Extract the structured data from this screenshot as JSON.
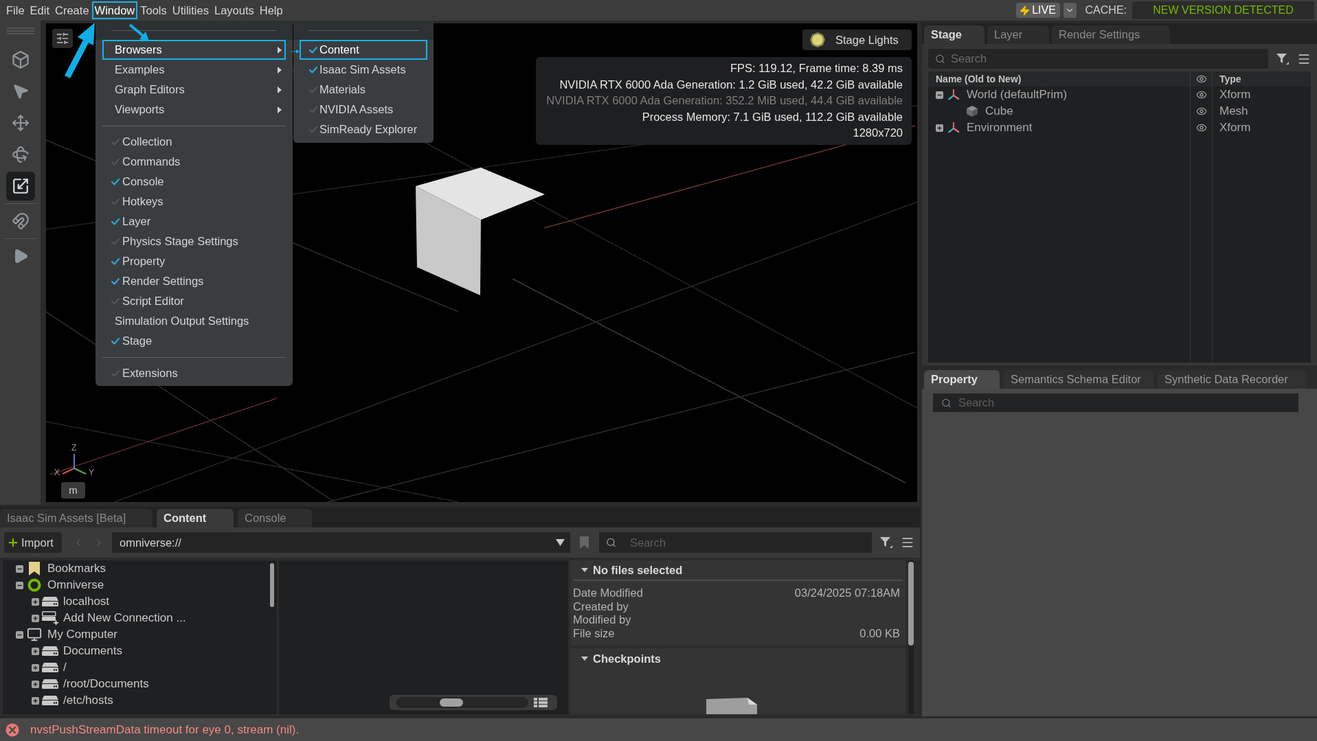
{
  "menubar": {
    "items": [
      {
        "label": "File",
        "selected": false
      },
      {
        "label": "Edit",
        "selected": false
      },
      {
        "label": "Create",
        "selected": false
      },
      {
        "label": "Window",
        "selected": true
      },
      {
        "label": "Tools",
        "selected": false
      },
      {
        "label": "Utilities",
        "selected": false
      },
      {
        "label": "Layouts",
        "selected": false
      },
      {
        "label": "Help",
        "selected": false
      }
    ],
    "live_button": "LIVE",
    "cache_label": "CACHE:",
    "cache_status": "NEW VERSION DETECTED"
  },
  "left_toolbar": {
    "groups": [
      {
        "tools": [
          {
            "kind": "select-mode",
            "selected": false
          },
          {
            "kind": "select",
            "selected": false
          },
          {
            "kind": "move",
            "selected": false
          },
          {
            "kind": "rotate",
            "selected": false
          },
          {
            "kind": "scale",
            "selected": true
          }
        ]
      },
      {
        "tools": [
          {
            "kind": "snap",
            "selected": false
          }
        ]
      },
      {
        "tools": [
          {
            "kind": "play",
            "selected": false
          }
        ]
      }
    ]
  },
  "window_menu": {
    "items": [
      {
        "kind": "submenu",
        "label": "Browsers",
        "selected": true
      },
      {
        "kind": "submenu",
        "label": "Examples",
        "selected": false
      },
      {
        "kind": "submenu",
        "label": "Graph Editors",
        "selected": false
      },
      {
        "kind": "submenu",
        "label": "Viewports",
        "selected": false
      },
      {
        "kind": "separator"
      },
      {
        "kind": "toggle",
        "label": "Collection",
        "checked": false
      },
      {
        "kind": "toggle",
        "label": "Commands",
        "checked": false
      },
      {
        "kind": "toggle",
        "label": "Console",
        "checked": true
      },
      {
        "kind": "toggle",
        "label": "Hotkeys",
        "checked": false
      },
      {
        "kind": "toggle",
        "label": "Layer",
        "checked": true
      },
      {
        "kind": "toggle",
        "label": "Physics Stage Settings",
        "checked": false
      },
      {
        "kind": "toggle",
        "label": "Property",
        "checked": true
      },
      {
        "kind": "toggle",
        "label": "Render Settings",
        "checked": true
      },
      {
        "kind": "toggle",
        "label": "Script Editor",
        "checked": false
      },
      {
        "kind": "plain",
        "label": "Simulation Output Settings"
      },
      {
        "kind": "toggle",
        "label": "Stage",
        "checked": true
      },
      {
        "kind": "separator"
      },
      {
        "kind": "toggle",
        "label": "Extensions",
        "checked": false
      }
    ]
  },
  "browsers_submenu": {
    "items": [
      {
        "label": "Content",
        "checked": true,
        "selected": true
      },
      {
        "label": "Isaac Sim Assets",
        "checked": true,
        "selected": false
      },
      {
        "label": "Materials",
        "checked": false,
        "selected": false
      },
      {
        "label": "NVIDIA Assets",
        "checked": false,
        "selected": false
      },
      {
        "label": "SimReady Explorer",
        "checked": false,
        "selected": false
      }
    ]
  },
  "viewport": {
    "stage_lights": "Stage Lights",
    "stats": [
      {
        "text": "FPS: 119.12, Frame time: 8.39 ms",
        "dimmed": false
      },
      {
        "text": "NVIDIA RTX 6000 Ada Generation: 1.2 GiB used, 42.2 GiB available",
        "dimmed": false
      },
      {
        "text": "NVIDIA RTX 6000 Ada Generation: 352.2 MiB used, 44.4 GiB available",
        "dimmed": true
      },
      {
        "text": "Process Memory: 7.1 GiB used, 112.2 GiB available",
        "dimmed": false
      },
      {
        "text": "1280x720",
        "dimmed": false
      }
    ],
    "axes": [
      "Z",
      "X",
      "Y"
    ],
    "unit_button": "m"
  },
  "stage_panel": {
    "tabs": [
      {
        "label": "Stage",
        "selected": true
      },
      {
        "label": "Layer",
        "selected": false
      },
      {
        "label": "Render Settings",
        "selected": false
      }
    ],
    "search": {
      "placeholder": "Search"
    },
    "columns": [
      "Name (Old to New)",
      "Type"
    ],
    "tree": [
      {
        "name": "World (defaultPrim)",
        "type": "Xform",
        "kind": "xform",
        "expanded": true,
        "children": [
          {
            "name": "Cube",
            "type": "Mesh",
            "kind": "mesh"
          }
        ]
      },
      {
        "name": "Environment",
        "type": "Xform",
        "kind": "xform",
        "expanded": false
      }
    ]
  },
  "property_panel": {
    "tabs": [
      {
        "label": "Property",
        "selected": true
      },
      {
        "label": "Semantics Schema Editor",
        "selected": false
      },
      {
        "label": "Synthetic Data Recorder",
        "selected": false
      }
    ],
    "search": {
      "placeholder": "Search"
    }
  },
  "content_panel": {
    "tabs": [
      {
        "label": "Isaac Sim Assets [Beta]",
        "selected": false
      },
      {
        "label": "Content",
        "selected": true
      },
      {
        "label": "Console",
        "selected": false
      }
    ],
    "import_button": "Import",
    "path": "omniverse://",
    "search": {
      "placeholder": "Search"
    },
    "tree": [
      {
        "label": "Bookmarks",
        "kind": "bookmarks",
        "expanded": true
      },
      {
        "label": "Omniverse",
        "kind": "omniverse",
        "expanded": true,
        "children": [
          {
            "label": "localhost",
            "kind": "server",
            "expanded": false
          },
          {
            "label": "Add New Connection ...",
            "kind": "add-connection",
            "expanded": false
          }
        ]
      },
      {
        "label": "My Computer",
        "kind": "computer",
        "expanded": true,
        "children": [
          {
            "label": "Documents",
            "kind": "drive",
            "expanded": false
          },
          {
            "label": "/",
            "kind": "drive",
            "expanded": false
          },
          {
            "label": "/root/Documents",
            "kind": "drive",
            "expanded": false
          },
          {
            "label": "/etc/hosts",
            "kind": "drive",
            "expanded": false
          }
        ]
      }
    ],
    "thumbnail_slider": {
      "level": 0.4
    },
    "details": {
      "header": "No files selected",
      "expanded": true,
      "fields": [
        {
          "label": "Date Modified",
          "value": "03/24/2025 07:18AM"
        },
        {
          "label": "Created by"
        },
        {
          "label": "Modified by"
        },
        {
          "label": "File size",
          "value": "0.00 KB"
        }
      ]
    },
    "checkpoints": {
      "header": "Checkpoints",
      "expanded": true
    }
  },
  "status_bar": {
    "kind": "error",
    "message": "nvstPushStreamData timeout for eye 0, stream (nil)."
  }
}
